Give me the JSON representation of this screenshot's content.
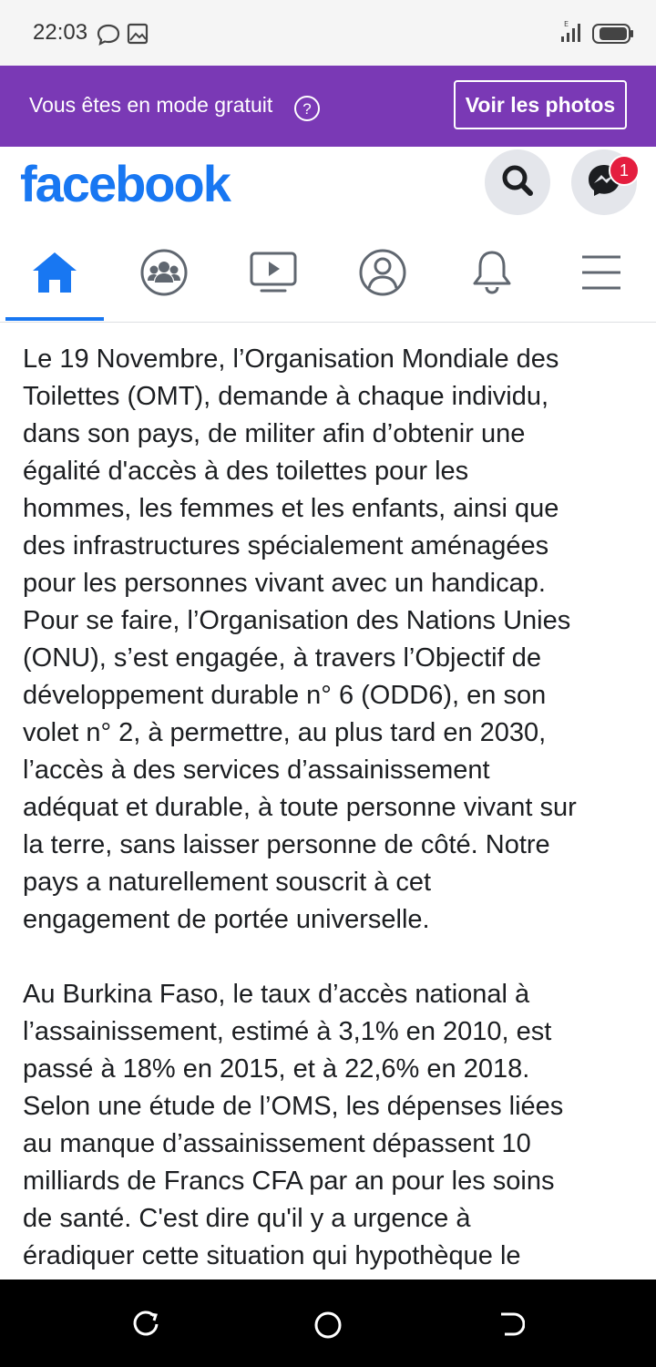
{
  "status_bar": {
    "time": "22:03"
  },
  "banner": {
    "text": "Vous êtes en mode gratuit",
    "button_label": "Voir les photos"
  },
  "header": {
    "logo": "facebook",
    "messenger_badge": "1"
  },
  "nav": {
    "tabs": [
      {
        "icon": "home-icon",
        "active": true
      },
      {
        "icon": "groups-icon",
        "active": false
      },
      {
        "icon": "watch-icon",
        "active": false
      },
      {
        "icon": "profile-icon",
        "active": false
      },
      {
        "icon": "bell-icon",
        "active": false
      },
      {
        "icon": "menu-icon",
        "active": false
      }
    ]
  },
  "post": {
    "paragraph1": [
      "Le 19 Novembre, l’Organisation Mondiale des",
      "Toilettes (OMT), demande à chaque individu,",
      "dans son pays, de militer afin d’obtenir une",
      "égalité d'accès à des toilettes pour les",
      "hommes, les femmes et les enfants, ainsi que",
      "des infrastructures spécialement aménagées",
      "pour les personnes vivant avec un handicap.",
      "Pour se faire, l’Organisation des Nations Unies",
      "(ONU), s’est engagée, à travers l’Objectif de",
      "développement durable n° 6 (ODD6), en son",
      "volet n° 2, à permettre,  au plus tard en 2030,",
      "l’accès à des services d’assainissement",
      "adéquat et durable, à toute personne vivant sur",
      "la terre, sans laisser personne de côté. Notre",
      "pays a naturellement souscrit à cet",
      "engagement de portée universelle."
    ],
    "paragraph2": [
      "Au Burkina Faso, le taux d’accès national à",
      "l’assainissement, estimé à 3,1% en 2010, est",
      "passé à 18% en 2015, et à 22,6% en 2018.",
      "Selon une étude de l’OMS, les dépenses liées",
      "au manque d’assainissement dépassent 10",
      "milliards de Francs CFA par an pour les soins",
      "de santé. C'est dire qu'il y a urgence à",
      "éradiquer cette situation qui hypothèque le"
    ]
  },
  "colors": {
    "banner_bg": "#7a39b5",
    "facebook_blue": "#1877f2",
    "badge_red": "#e41e3f",
    "icon_gray": "#606770"
  }
}
